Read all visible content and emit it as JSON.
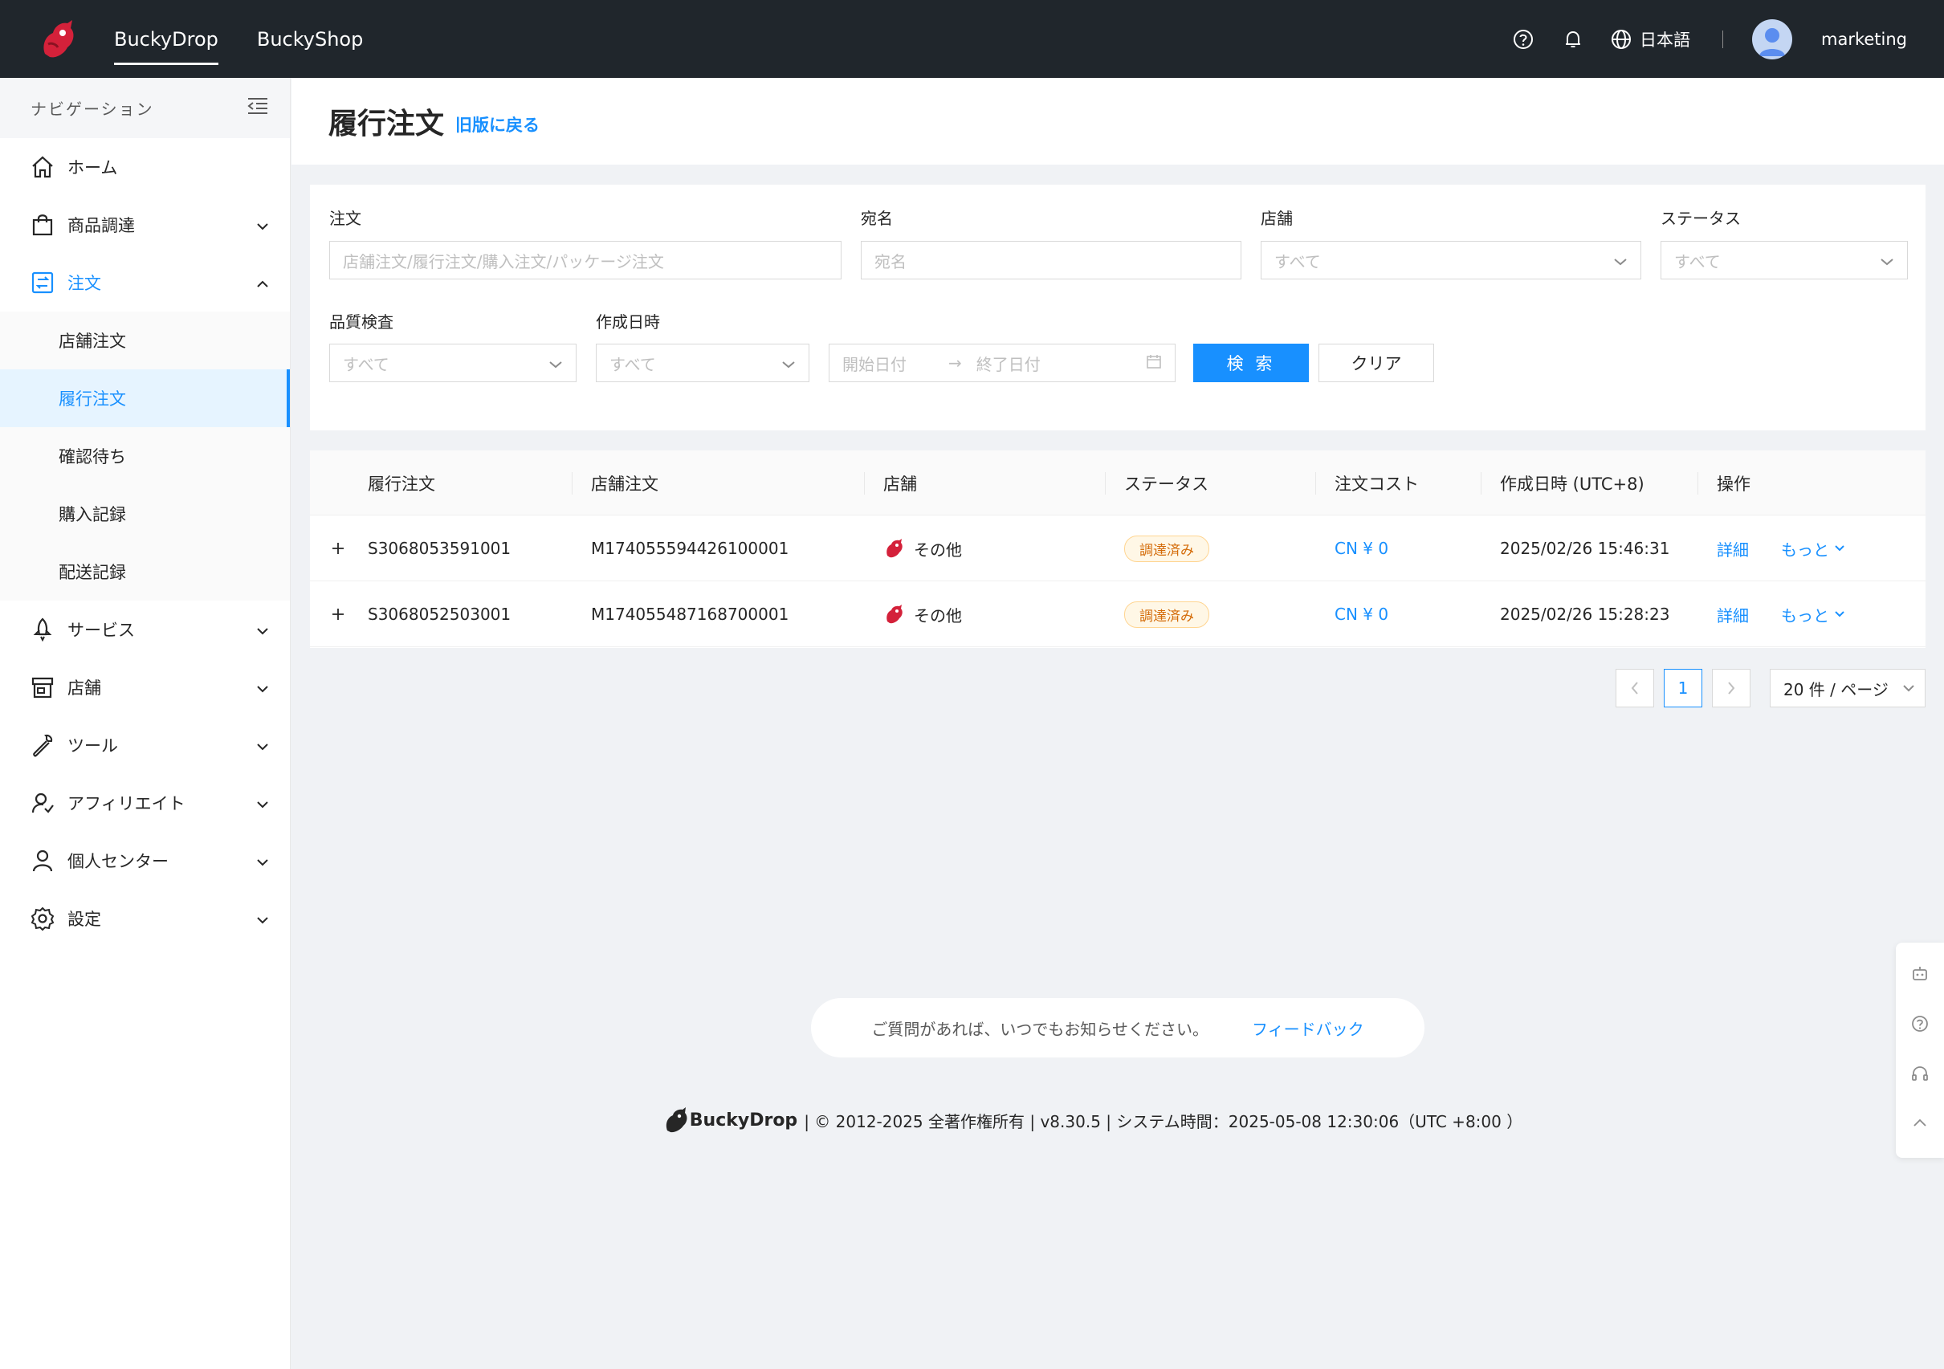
{
  "topbar": {
    "tabs": [
      {
        "label": "BuckyDrop"
      },
      {
        "label": "BuckyShop"
      }
    ],
    "language": "日本語",
    "username": "marketing"
  },
  "sidebar": {
    "header": "ナビゲーション",
    "items": [
      {
        "label": "ホーム",
        "icon": "home-icon"
      },
      {
        "label": "商品調達",
        "icon": "bag-icon"
      },
      {
        "label": "注文",
        "icon": "order-icon"
      },
      {
        "label": "サービス",
        "icon": "rocket-icon"
      },
      {
        "label": "店舗",
        "icon": "store-icon"
      },
      {
        "label": "ツール",
        "icon": "wrench-icon"
      },
      {
        "label": "アフィリエイト",
        "icon": "affiliate-icon"
      },
      {
        "label": "個人センター",
        "icon": "user-icon"
      },
      {
        "label": "設定",
        "icon": "gear-icon"
      }
    ],
    "order_sub": [
      {
        "label": "店舗注文"
      },
      {
        "label": "履行注文"
      },
      {
        "label": "確認待ち"
      },
      {
        "label": "購入記録"
      },
      {
        "label": "配送記録"
      }
    ]
  },
  "page": {
    "title": "履行注文",
    "old_version_link": "旧版に戻る"
  },
  "filters": {
    "order_label": "注文",
    "order_placeholder": "店舗注文/履行注文/購入注文/パッケージ注文",
    "recipient_label": "宛名",
    "recipient_placeholder": "宛名",
    "store_label": "店舗",
    "store_value": "すべて",
    "status_label": "ステータス",
    "status_value": "すべて",
    "qc_label": "品質検査",
    "qc_value": "すべて",
    "created_label": "作成日時",
    "created_value": "すべて",
    "start_date": "開始日付",
    "end_date": "終了日付",
    "search_button": "検 索",
    "clear_button": "クリア"
  },
  "table": {
    "columns": [
      "履行注文",
      "店舗注文",
      "店舗",
      "ステータス",
      "注文コスト",
      "作成日時 (UTC+8)",
      "操作"
    ],
    "rows": [
      {
        "fulfillment": "S3068053591001",
        "store_order": "M174055594426100001",
        "store": "その他",
        "status": "調達済み",
        "cost": "CN ¥ 0",
        "created": "2025/02/26 15:46:31",
        "detail": "詳細",
        "more": "もっと"
      },
      {
        "fulfillment": "S3068052503001",
        "store_order": "M174055487168700001",
        "store": "その他",
        "status": "調達済み",
        "cost": "CN ¥ 0",
        "created": "2025/02/26 15:28:23",
        "detail": "詳細",
        "more": "もっと"
      }
    ]
  },
  "pagination": {
    "current": "1",
    "page_size": "20 件 / ページ"
  },
  "feedback": {
    "text": "ご質問があれば、いつでもお知らせください。",
    "link": "フィードバック"
  },
  "footer": {
    "brand": "BuckyDrop",
    "text": "| © 2012-2025 全著作権所有 | v8.30.5 | システム時間：2025-05-08 12:30:06（UTC +8:00 ）"
  },
  "colors": {
    "primary": "#1890ff",
    "topbar": "#20262c",
    "tag_text": "#d46b08",
    "logo_red": "#d4213a"
  }
}
